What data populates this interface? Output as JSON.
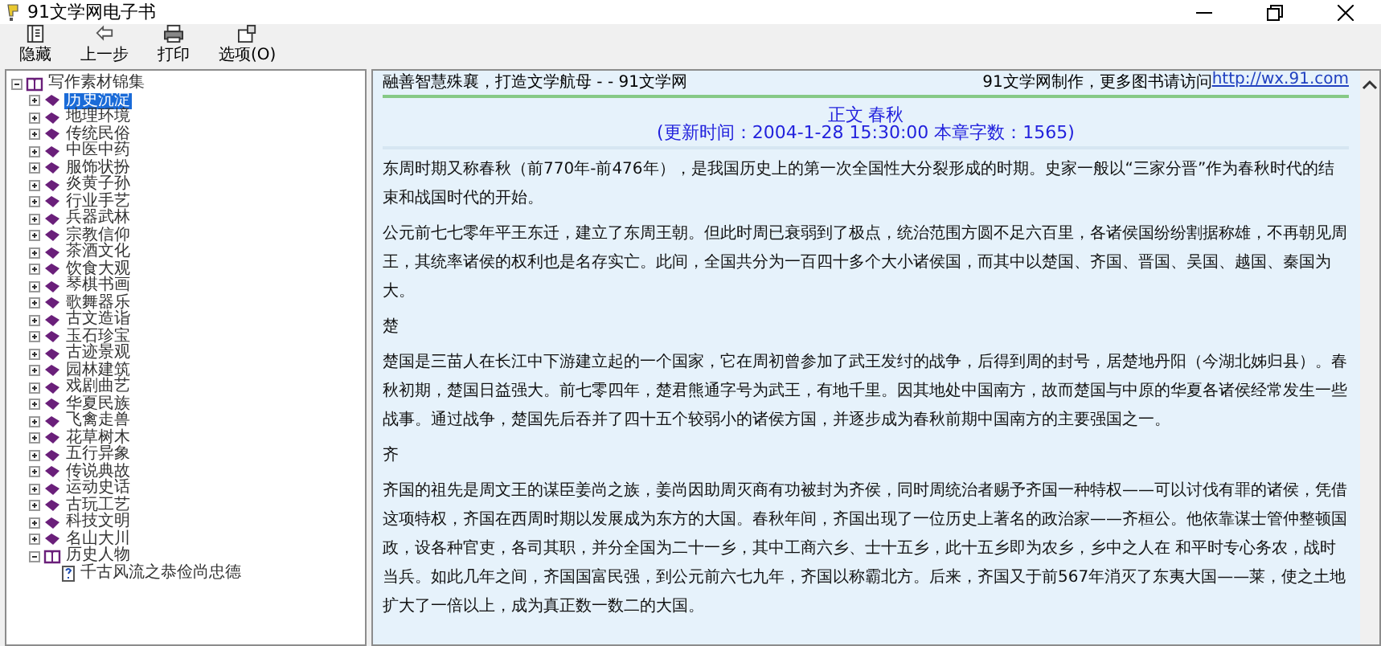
{
  "window": {
    "title": "91文学网电子书"
  },
  "toolbar": [
    {
      "label": "隐藏",
      "kind": "hide"
    },
    {
      "label": "上一步",
      "kind": "back"
    },
    {
      "label": "打印",
      "kind": "print"
    },
    {
      "label": "选项(O)",
      "kind": "options"
    }
  ],
  "tree": [
    {
      "label": "写作素材锦集",
      "kind": "book",
      "expanded": true,
      "selected": false,
      "children": [
        {
          "label": "历史沉淀",
          "kind": "book",
          "expanded": false,
          "selected": true
        },
        {
          "label": "地理环境",
          "kind": "book",
          "expanded": false,
          "selected": false
        },
        {
          "label": "传统民俗",
          "kind": "book",
          "expanded": false,
          "selected": false
        },
        {
          "label": "中医中药",
          "kind": "book",
          "expanded": false,
          "selected": false
        },
        {
          "label": "服饰状扮",
          "kind": "book",
          "expanded": false,
          "selected": false
        },
        {
          "label": "炎黄子孙",
          "kind": "book",
          "expanded": false,
          "selected": false
        },
        {
          "label": "行业手艺",
          "kind": "book",
          "expanded": false,
          "selected": false
        },
        {
          "label": "兵器武林",
          "kind": "book",
          "expanded": false,
          "selected": false
        },
        {
          "label": "宗教信仰",
          "kind": "book",
          "expanded": false,
          "selected": false
        },
        {
          "label": "茶酒文化",
          "kind": "book",
          "expanded": false,
          "selected": false
        },
        {
          "label": "饮食大观",
          "kind": "book",
          "expanded": false,
          "selected": false
        },
        {
          "label": "琴棋书画",
          "kind": "book",
          "expanded": false,
          "selected": false
        },
        {
          "label": "歌舞器乐",
          "kind": "book",
          "expanded": false,
          "selected": false
        },
        {
          "label": "古文造诣",
          "kind": "book",
          "expanded": false,
          "selected": false
        },
        {
          "label": "玉石珍宝",
          "kind": "book",
          "expanded": false,
          "selected": false
        },
        {
          "label": "古迹景观",
          "kind": "book",
          "expanded": false,
          "selected": false
        },
        {
          "label": "园林建筑",
          "kind": "book",
          "expanded": false,
          "selected": false
        },
        {
          "label": "戏剧曲艺",
          "kind": "book",
          "expanded": false,
          "selected": false
        },
        {
          "label": "华夏民族",
          "kind": "book",
          "expanded": false,
          "selected": false
        },
        {
          "label": "飞禽走兽",
          "kind": "book",
          "expanded": false,
          "selected": false
        },
        {
          "label": "花草树木",
          "kind": "book",
          "expanded": false,
          "selected": false
        },
        {
          "label": "五行异象",
          "kind": "book",
          "expanded": false,
          "selected": false
        },
        {
          "label": "传说典故",
          "kind": "book",
          "expanded": false,
          "selected": false
        },
        {
          "label": "运动史话",
          "kind": "book",
          "expanded": false,
          "selected": false
        },
        {
          "label": "古玩工艺",
          "kind": "book",
          "expanded": false,
          "selected": false
        },
        {
          "label": "科技文明",
          "kind": "book",
          "expanded": false,
          "selected": false
        },
        {
          "label": "名山大川",
          "kind": "book",
          "expanded": false,
          "selected": false
        },
        {
          "label": "历史人物",
          "kind": "book",
          "expanded": true,
          "selected": false,
          "children": [
            {
              "label": "千古风流之恭俭尚忠德",
              "kind": "page",
              "selected": false
            }
          ]
        }
      ]
    }
  ],
  "content": {
    "header_left": "融善智慧殊襄，打造文学航母 - - 91文学网",
    "header_right": "91文学网制作，更多图书请访问",
    "header_link": "http://wx.91.com",
    "title": "正文 春秋",
    "subtitle": "(更新时间：2004-1-28 15:30:00  本章字数：1565)",
    "paragraphs": [
      "东周时期又称春秋（前770年-前476年），是我国历史上的第一次全国性大分裂形成的时期。史家一般以“三家分晋”作为春秋时代的结束和战国时代的开始。",
      "公元前七七零年平王东迁，建立了东周王朝。但此时周已衰弱到了极点，统治范围方圆不足六百里，各诸侯国纷纷割据称雄，不再朝见周王，其统率诸侯的权利也是名存实亡。此间，全国共分为一百四十多个大小诸侯国，而其中以楚国、齐国、晋国、吴国、越国、秦国为大。",
      "楚",
      "楚国是三苗人在长江中下游建立起的一个国家，它在周初曾参加了武王发纣的战争，后得到周的封号，居楚地丹阳（今湖北姊归县）。春秋初期，楚国日益强大。前七零四年，楚君熊通字号为武王，有地千里。因其地处中国南方，故而楚国与中原的华夏各诸侯经常发生一些战事。通过战争，楚国先后吞并了四十五个较弱小的诸侯方国，并逐步成为春秋前期中国南方的主要强国之一。",
      "齐",
      "齐国的祖先是周文王的谋臣姜尚之族，姜尚因助周灭商有功被封为齐侯，同时周统治者赐予齐国一种特权——可以讨伐有罪的诸侯，凭借这项特权，齐国在西周时期以发展成为东方的大国。春秋年间，齐国出现了一位历史上著名的政治家——齐桓公。他依靠谋士管仲整顿国政，设各种官吏，各司其职，并分全国为二十一乡，其中工商六乡、士十五乡，此十五乡即为农乡，乡中之人在 和平时专心务农，战时当兵。如此几年之间，齐国国富民强，到公元前六七九年，齐国以称霸北方。后来，齐国又于前567年消灭了东夷大国——莱，使之土地扩大了一倍以上，成为真正数一数二的大国。"
    ]
  }
}
